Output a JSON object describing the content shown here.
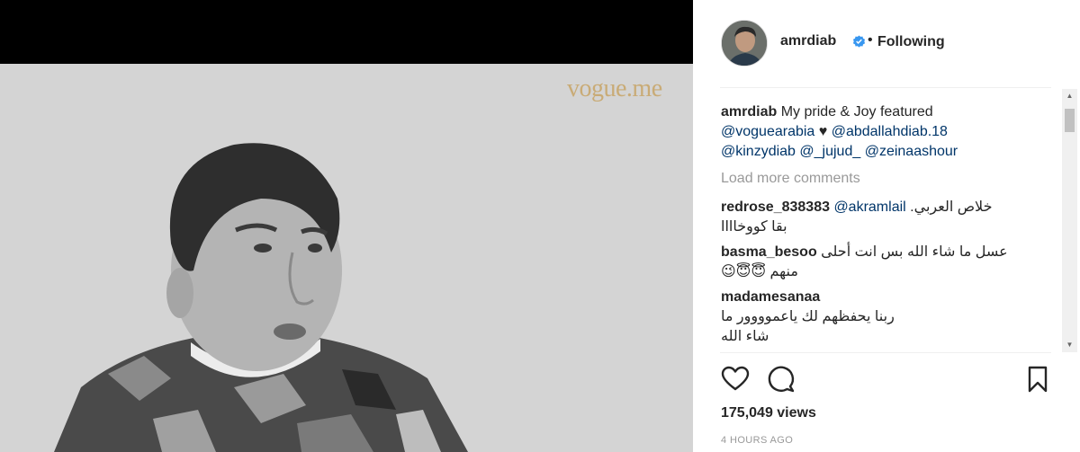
{
  "media": {
    "watermark": "vogue.me"
  },
  "header": {
    "username": "amrdiab",
    "separator": "•",
    "follow_status": "Following"
  },
  "caption": {
    "username": "amrdiab",
    "text": "My pride & Joy featured",
    "mention_1": "@voguearabia",
    "heart": "♥",
    "mention_2": "@abdallahdiab.18",
    "mention_3": "@kinzydiab",
    "mention_4": "@_jujud_",
    "mention_5": "@zeinaashour"
  },
  "load_more": "Load more comments",
  "comments": [
    {
      "username": "redrose_838383",
      "mention": "@akramlail",
      "text_1": "خلاص العربي.",
      "text_2": "بقا كووخاااا"
    },
    {
      "username": "basma_besoo",
      "text_1": "عسل ما شاء الله بس انت أحلى",
      "text_2": "منهم",
      "emojis": "😉😇😇"
    },
    {
      "username": "madamesanaa",
      "text_1": "ربنا يحفظهم لك ياعموووور ما",
      "text_2": "شاء الله"
    }
  ],
  "stats": {
    "views": "175,049 views",
    "time": "4 HOURS AGO"
  },
  "icons": {
    "like": "heart-outline-icon",
    "comment": "speech-bubble-icon",
    "save": "bookmark-icon",
    "verified": "verified-badge-icon"
  },
  "colors": {
    "link": "#003569",
    "verified": "#3897f0",
    "muted": "#999999",
    "text": "#262626"
  }
}
